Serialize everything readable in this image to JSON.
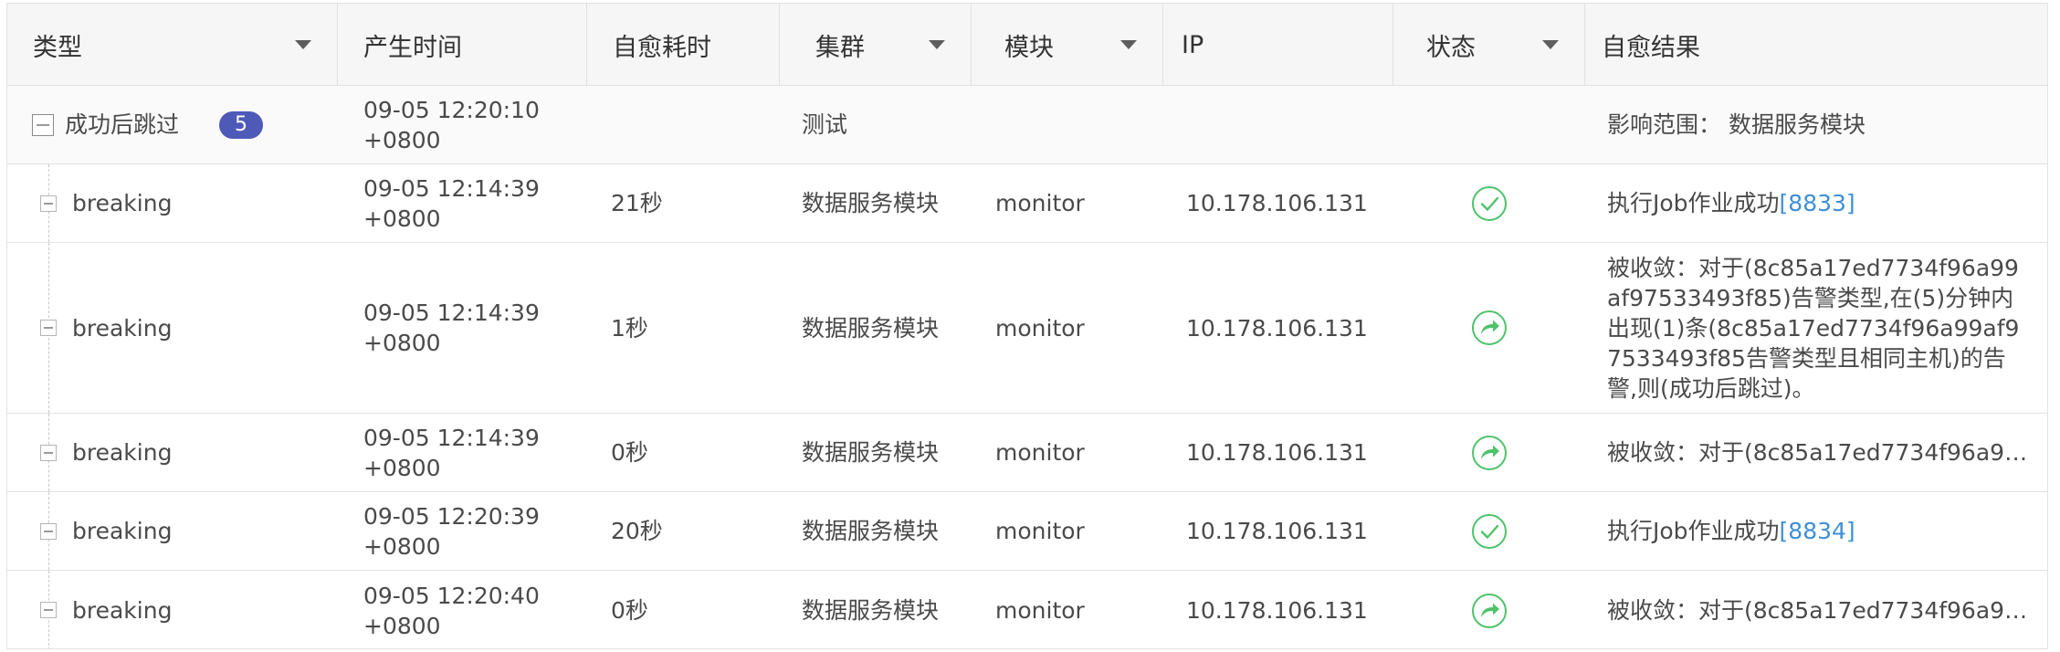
{
  "columns": [
    {
      "label": "类型",
      "filter": true
    },
    {
      "label": "产生时间",
      "filter": false
    },
    {
      "label": "自愈耗时",
      "filter": false
    },
    {
      "label": "集群",
      "filter": true
    },
    {
      "label": "模块",
      "filter": true
    },
    {
      "label": "IP",
      "filter": false
    },
    {
      "label": "状态",
      "filter": true
    },
    {
      "label": "自愈结果",
      "filter": false
    }
  ],
  "group": {
    "label": "成功后跳过",
    "count": "5",
    "time_line1": "09-05 12:20:10",
    "time_line2": "+0800",
    "cluster": "测试",
    "result": "影响范围： 数据服务模块"
  },
  "rows": [
    {
      "type": "breaking",
      "time_line1": "09-05 12:14:39",
      "time_line2": "+0800",
      "duration": "21秒",
      "cluster": "数据服务模块",
      "module": "monitor",
      "ip": "10.178.106.131",
      "status_icon": "check-icon",
      "result_text": "执行Job作业成功",
      "result_link": "[8833]"
    },
    {
      "type": "breaking",
      "time_line1": "09-05 12:14:39",
      "time_line2": "+0800",
      "duration": "1秒",
      "cluster": "数据服务模块",
      "module": "monitor",
      "ip": "10.178.106.131",
      "status_icon": "forward-icon",
      "result_text": "被收敛：对于(8c85a17ed7734f96a99af97533493f85)告警类型,在(5)分钟内出现(1)条(8c85a17ed7734f96a99af97533493f85告警类型且相同主机)的告警,则(成功后跳过)。",
      "result_link": ""
    },
    {
      "type": "breaking",
      "time_line1": "09-05 12:14:39",
      "time_line2": "+0800",
      "duration": "0秒",
      "cluster": "数据服务模块",
      "module": "monitor",
      "ip": "10.178.106.131",
      "status_icon": "forward-icon",
      "result_text": "被收敛：对于(8c85a17ed7734f96a99a...",
      "result_link": ""
    },
    {
      "type": "breaking",
      "time_line1": "09-05 12:20:39",
      "time_line2": "+0800",
      "duration": "20秒",
      "cluster": "数据服务模块",
      "module": "monitor",
      "ip": "10.178.106.131",
      "status_icon": "check-icon",
      "result_text": "执行Job作业成功",
      "result_link": "[8834]"
    },
    {
      "type": "breaking",
      "time_line1": "09-05 12:20:40",
      "time_line2": "+0800",
      "duration": "0秒",
      "cluster": "数据服务模块",
      "module": "monitor",
      "ip": "10.178.106.131",
      "status_icon": "forward-icon",
      "result_text": "被收敛：对于(8c85a17ed7734f96a99a...",
      "result_link": ""
    }
  ],
  "colors": {
    "status_green": "#4fc26a",
    "badge": "#4e59b8",
    "link": "#3f8fd6"
  }
}
